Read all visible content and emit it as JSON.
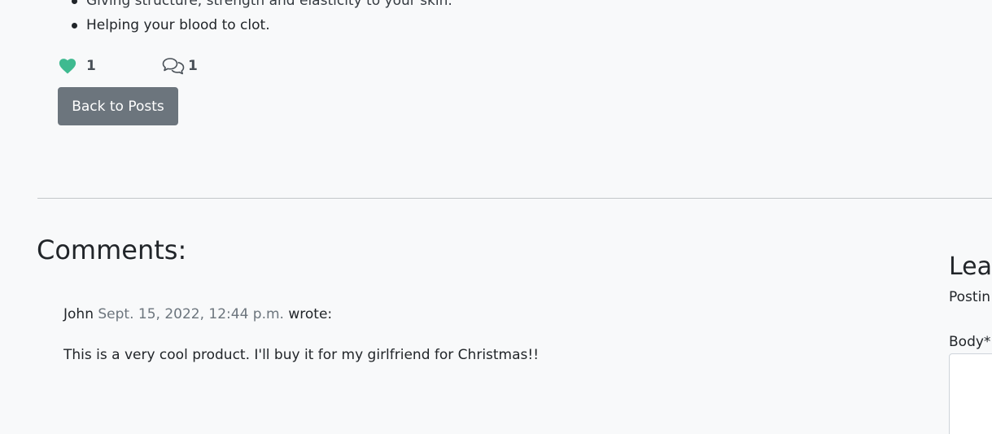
{
  "post": {
    "bullets": [
      "Giving structure, strength and elasticity to your skin.",
      "Helping your blood to clot."
    ],
    "likes_count": "1",
    "comments_count": "1",
    "back_label": "Back to Posts"
  },
  "comments_section": {
    "heading": "Comments:",
    "comments": [
      {
        "author": "John",
        "date": "Sept. 15, 2022, 12:44 p.m.",
        "wrote": "wrote:",
        "body": "This is a very cool product. I'll buy it for my girlfriend for Christmas!!"
      }
    ]
  },
  "comment_form": {
    "heading": "Lea",
    "note": "Postin",
    "body_label": "Body*"
  },
  "colors": {
    "background": "#f8f9fa",
    "like_icon": "#3fba90",
    "button_bg": "#6c757d",
    "date_text": "#6c757d"
  },
  "icons": {
    "like": "heart-icon",
    "comments": "chat-bubbles-icon"
  }
}
